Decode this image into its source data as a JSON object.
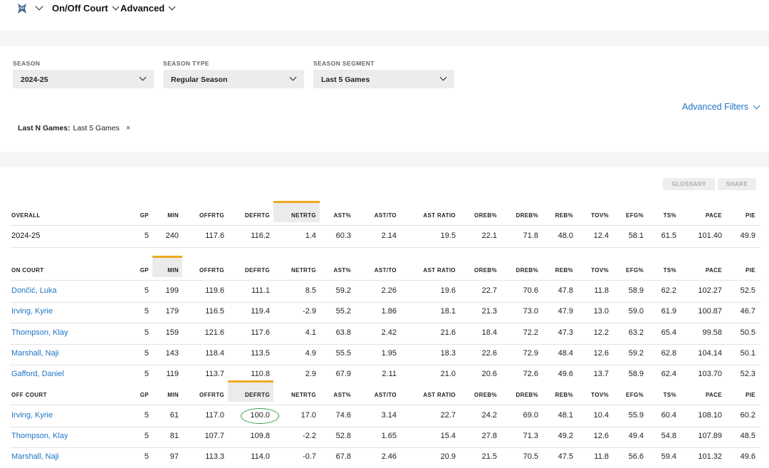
{
  "nav": {
    "team_logo": "mavericks-logo-icon",
    "items": [
      {
        "label": "On/Off Court"
      },
      {
        "label": "Advanced"
      }
    ]
  },
  "filters": {
    "season": {
      "label": "SEASON",
      "value": "2024-25"
    },
    "season_type": {
      "label": "SEASON TYPE",
      "value": "Regular Season"
    },
    "season_segment": {
      "label": "SEASON SEGMENT",
      "value": "Last 5 Games"
    },
    "advanced_filters_label": "Advanced Filters",
    "chip": {
      "key": "Last N Games:",
      "value": "Last 5 Games",
      "remove": "×"
    }
  },
  "buttons": {
    "glossary": "GLOSSARY",
    "share": "SHARE"
  },
  "colors": {
    "link": "#1d74c4",
    "accent": "#f0a91f",
    "highlight_bg": "#ebebeb",
    "annotation": "#2ea043"
  },
  "columns": [
    "GP",
    "MIN",
    "OFFRTG",
    "DEFRTG",
    "NETRTG",
    "AST%",
    "AST/TO",
    "AST RATIO",
    "OREB%",
    "DREB%",
    "REB%",
    "TOV%",
    "EFG%",
    "TS%",
    "PACE",
    "PIE"
  ],
  "sections": [
    {
      "title": "OVERALL",
      "sorted_column": "NETRTG",
      "rows": [
        {
          "name": "2024-25",
          "values": [
            "5",
            "240",
            "117.6",
            "116.2",
            "1.4",
            "60.3",
            "2.14",
            "19.5",
            "22.1",
            "71.8",
            "48.0",
            "12.4",
            "58.1",
            "61.5",
            "101.40",
            "49.9"
          ]
        }
      ]
    },
    {
      "title": "ON COURT",
      "sorted_column": "MIN",
      "rows": [
        {
          "name": "Dončić, Luka",
          "values": [
            "5",
            "199",
            "119.6",
            "111.1",
            "8.5",
            "59.2",
            "2.26",
            "19.6",
            "22.7",
            "70.6",
            "47.8",
            "11.8",
            "58.9",
            "62.2",
            "102.27",
            "52.5"
          ]
        },
        {
          "name": "Irving, Kyrie",
          "values": [
            "5",
            "179",
            "116.5",
            "119.4",
            "-2.9",
            "55.2",
            "1.86",
            "18.1",
            "21.3",
            "73.0",
            "47.9",
            "13.0",
            "59.0",
            "61.9",
            "100.87",
            "46.7"
          ]
        },
        {
          "name": "Thompson, Klay",
          "values": [
            "5",
            "159",
            "121.6",
            "117.6",
            "4.1",
            "63.8",
            "2.42",
            "21.6",
            "18.4",
            "72.2",
            "47.3",
            "12.2",
            "63.2",
            "65.4",
            "99.58",
            "50.5"
          ]
        },
        {
          "name": "Marshall, Naji",
          "values": [
            "5",
            "143",
            "118.4",
            "113.5",
            "4.9",
            "55.5",
            "1.95",
            "18.3",
            "22.6",
            "72.9",
            "48.4",
            "12.6",
            "59.2",
            "62.8",
            "104.14",
            "50.1"
          ]
        },
        {
          "name": "Gafford, Daniel",
          "values": [
            "5",
            "119",
            "113.7",
            "110.8",
            "2.9",
            "67.9",
            "2.11",
            "21.0",
            "20.6",
            "72.6",
            "49.6",
            "13.7",
            "58.9",
            "62.4",
            "103.70",
            "52.3"
          ]
        }
      ]
    },
    {
      "title": "OFF COURT",
      "sorted_column": "DEFRTG",
      "rows": [
        {
          "name": "Irving, Kyrie",
          "values": [
            "5",
            "61",
            "117.0",
            "100.0",
            "17.0",
            "74.6",
            "3.14",
            "22.7",
            "24.2",
            "69.0",
            "48.1",
            "10.4",
            "55.9",
            "60.4",
            "108.10",
            "60.2"
          ]
        },
        {
          "name": "Thompson, Klay",
          "values": [
            "5",
            "81",
            "107.7",
            "109.8",
            "-2.2",
            "52.8",
            "1.65",
            "15.4",
            "27.8",
            "71.3",
            "49.2",
            "12.6",
            "49.4",
            "54.8",
            "107.89",
            "48.5"
          ]
        },
        {
          "name": "Marshall, Naji",
          "values": [
            "5",
            "97",
            "113.3",
            "114.0",
            "-0.7",
            "67.8",
            "2.46",
            "20.9",
            "21.5",
            "70.5",
            "47.5",
            "11.8",
            "56.6",
            "59.4",
            "101.32",
            "49.6"
          ]
        }
      ]
    }
  ],
  "annotation": {
    "type": "circle",
    "section": 2,
    "row": 0,
    "column": "DEFRTG"
  }
}
